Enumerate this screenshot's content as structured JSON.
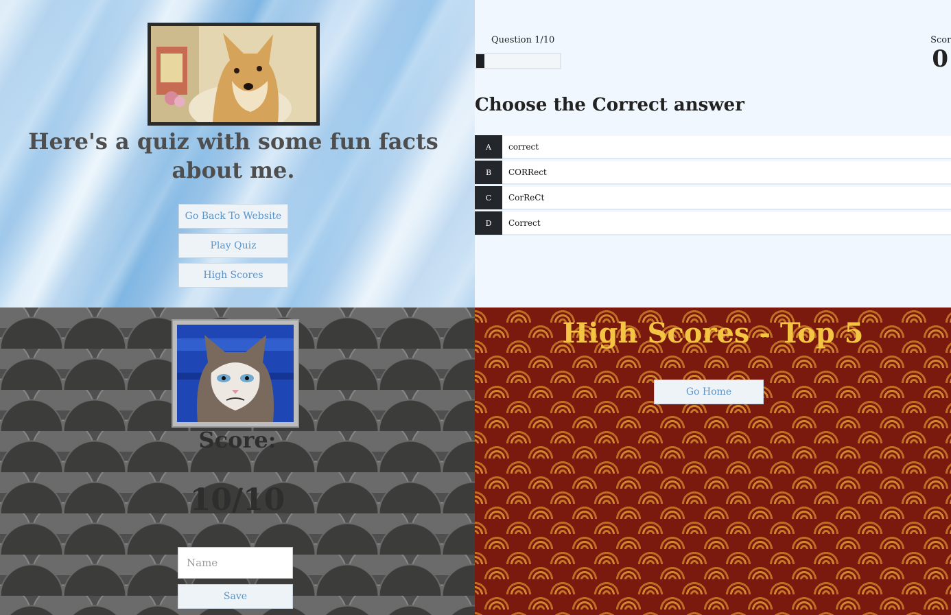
{
  "home": {
    "title": "Here's a quiz with some fun facts about me.",
    "buttons": {
      "back": "Go Back To Website",
      "play": "Play Quiz",
      "highscores": "High Scores"
    }
  },
  "quiz": {
    "question_counter": "Question 1/10",
    "progress": 0.1,
    "score_label": "Score",
    "score_value": "0",
    "question": "Choose the Correct answer",
    "choices": [
      {
        "letter": "A",
        "text": "correct"
      },
      {
        "letter": "B",
        "text": "CORRect"
      },
      {
        "letter": "C",
        "text": "CorReCt"
      },
      {
        "letter": "D",
        "text": "Correct"
      }
    ]
  },
  "end": {
    "score_label": "Score:",
    "final_score": "10/10",
    "name_placeholder": "Name",
    "save_label": "Save"
  },
  "highscores": {
    "title": "High Scores - Top 5",
    "home_label": "Go Home"
  },
  "colors": {
    "link_blue": "#5a94c8",
    "title_gold": "#f4c542",
    "dark": "#1d1f22"
  }
}
